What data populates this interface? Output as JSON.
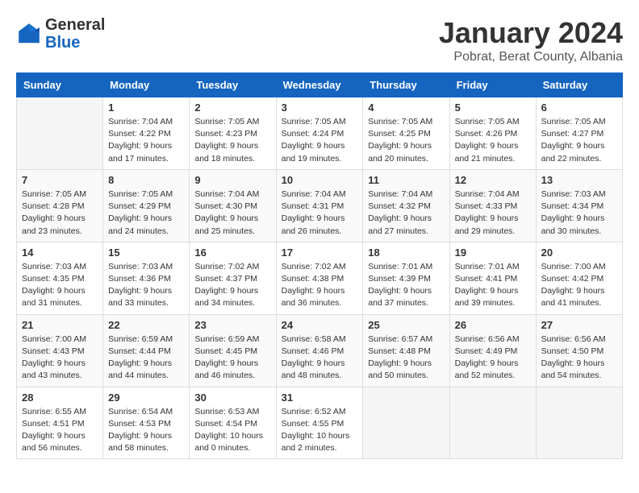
{
  "logo": {
    "general": "General",
    "blue": "Blue"
  },
  "header": {
    "month": "January 2024",
    "location": "Pobrat, Berat County, Albania"
  },
  "weekdays": [
    "Sunday",
    "Monday",
    "Tuesday",
    "Wednesday",
    "Thursday",
    "Friday",
    "Saturday"
  ],
  "weeks": [
    [
      {
        "day": "",
        "info": ""
      },
      {
        "day": "1",
        "info": "Sunrise: 7:04 AM\nSunset: 4:22 PM\nDaylight: 9 hours\nand 17 minutes."
      },
      {
        "day": "2",
        "info": "Sunrise: 7:05 AM\nSunset: 4:23 PM\nDaylight: 9 hours\nand 18 minutes."
      },
      {
        "day": "3",
        "info": "Sunrise: 7:05 AM\nSunset: 4:24 PM\nDaylight: 9 hours\nand 19 minutes."
      },
      {
        "day": "4",
        "info": "Sunrise: 7:05 AM\nSunset: 4:25 PM\nDaylight: 9 hours\nand 20 minutes."
      },
      {
        "day": "5",
        "info": "Sunrise: 7:05 AM\nSunset: 4:26 PM\nDaylight: 9 hours\nand 21 minutes."
      },
      {
        "day": "6",
        "info": "Sunrise: 7:05 AM\nSunset: 4:27 PM\nDaylight: 9 hours\nand 22 minutes."
      }
    ],
    [
      {
        "day": "7",
        "info": "Sunrise: 7:05 AM\nSunset: 4:28 PM\nDaylight: 9 hours\nand 23 minutes."
      },
      {
        "day": "8",
        "info": "Sunrise: 7:05 AM\nSunset: 4:29 PM\nDaylight: 9 hours\nand 24 minutes."
      },
      {
        "day": "9",
        "info": "Sunrise: 7:04 AM\nSunset: 4:30 PM\nDaylight: 9 hours\nand 25 minutes."
      },
      {
        "day": "10",
        "info": "Sunrise: 7:04 AM\nSunset: 4:31 PM\nDaylight: 9 hours\nand 26 minutes."
      },
      {
        "day": "11",
        "info": "Sunrise: 7:04 AM\nSunset: 4:32 PM\nDaylight: 9 hours\nand 27 minutes."
      },
      {
        "day": "12",
        "info": "Sunrise: 7:04 AM\nSunset: 4:33 PM\nDaylight: 9 hours\nand 29 minutes."
      },
      {
        "day": "13",
        "info": "Sunrise: 7:03 AM\nSunset: 4:34 PM\nDaylight: 9 hours\nand 30 minutes."
      }
    ],
    [
      {
        "day": "14",
        "info": "Sunrise: 7:03 AM\nSunset: 4:35 PM\nDaylight: 9 hours\nand 31 minutes."
      },
      {
        "day": "15",
        "info": "Sunrise: 7:03 AM\nSunset: 4:36 PM\nDaylight: 9 hours\nand 33 minutes."
      },
      {
        "day": "16",
        "info": "Sunrise: 7:02 AM\nSunset: 4:37 PM\nDaylight: 9 hours\nand 34 minutes."
      },
      {
        "day": "17",
        "info": "Sunrise: 7:02 AM\nSunset: 4:38 PM\nDaylight: 9 hours\nand 36 minutes."
      },
      {
        "day": "18",
        "info": "Sunrise: 7:01 AM\nSunset: 4:39 PM\nDaylight: 9 hours\nand 37 minutes."
      },
      {
        "day": "19",
        "info": "Sunrise: 7:01 AM\nSunset: 4:41 PM\nDaylight: 9 hours\nand 39 minutes."
      },
      {
        "day": "20",
        "info": "Sunrise: 7:00 AM\nSunset: 4:42 PM\nDaylight: 9 hours\nand 41 minutes."
      }
    ],
    [
      {
        "day": "21",
        "info": "Sunrise: 7:00 AM\nSunset: 4:43 PM\nDaylight: 9 hours\nand 43 minutes."
      },
      {
        "day": "22",
        "info": "Sunrise: 6:59 AM\nSunset: 4:44 PM\nDaylight: 9 hours\nand 44 minutes."
      },
      {
        "day": "23",
        "info": "Sunrise: 6:59 AM\nSunset: 4:45 PM\nDaylight: 9 hours\nand 46 minutes."
      },
      {
        "day": "24",
        "info": "Sunrise: 6:58 AM\nSunset: 4:46 PM\nDaylight: 9 hours\nand 48 minutes."
      },
      {
        "day": "25",
        "info": "Sunrise: 6:57 AM\nSunset: 4:48 PM\nDaylight: 9 hours\nand 50 minutes."
      },
      {
        "day": "26",
        "info": "Sunrise: 6:56 AM\nSunset: 4:49 PM\nDaylight: 9 hours\nand 52 minutes."
      },
      {
        "day": "27",
        "info": "Sunrise: 6:56 AM\nSunset: 4:50 PM\nDaylight: 9 hours\nand 54 minutes."
      }
    ],
    [
      {
        "day": "28",
        "info": "Sunrise: 6:55 AM\nSunset: 4:51 PM\nDaylight: 9 hours\nand 56 minutes."
      },
      {
        "day": "29",
        "info": "Sunrise: 6:54 AM\nSunset: 4:53 PM\nDaylight: 9 hours\nand 58 minutes."
      },
      {
        "day": "30",
        "info": "Sunrise: 6:53 AM\nSunset: 4:54 PM\nDaylight: 10 hours\nand 0 minutes."
      },
      {
        "day": "31",
        "info": "Sunrise: 6:52 AM\nSunset: 4:55 PM\nDaylight: 10 hours\nand 2 minutes."
      },
      {
        "day": "",
        "info": ""
      },
      {
        "day": "",
        "info": ""
      },
      {
        "day": "",
        "info": ""
      }
    ]
  ]
}
